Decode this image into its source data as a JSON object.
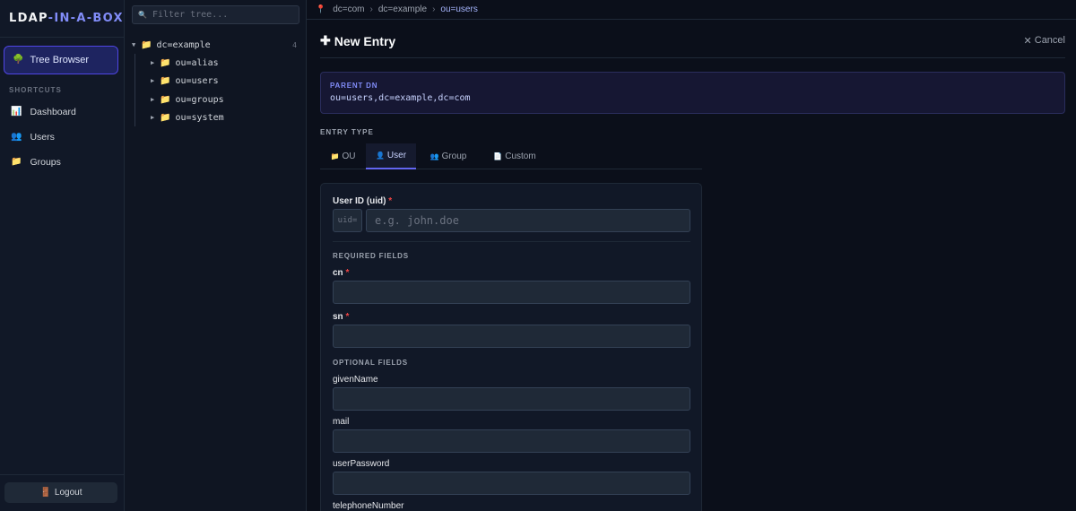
{
  "app": {
    "brand_a": "LDAP",
    "brand_b": "-IN-A-BOX"
  },
  "sidebar": {
    "active_item": {
      "label": "Tree Browser",
      "icon": "tree-icon"
    },
    "shortcuts_heading": "SHORTCUTS",
    "shortcuts": [
      {
        "label": "Dashboard",
        "icon": "chart-icon"
      },
      {
        "label": "Users",
        "icon": "users-icon"
      },
      {
        "label": "Groups",
        "icon": "folder-icon"
      }
    ],
    "logout_label": "Logout"
  },
  "tree": {
    "filter_placeholder": "Filter tree...",
    "root": {
      "label": "dc=example",
      "count": "4"
    },
    "children": [
      "ou=alias",
      "ou=users",
      "ou=groups",
      "ou=system"
    ]
  },
  "breadcrumb": [
    "dc=com",
    "dc=example",
    "ou=users"
  ],
  "form": {
    "title": "New Entry",
    "cancel_label": "Cancel",
    "parent_dn_label": "PARENT DN",
    "parent_dn_value": "ou=users,dc=example,dc=com",
    "entry_type_label": "ENTRY TYPE",
    "tabs": [
      {
        "label": "OU",
        "icon": "folder-icon",
        "active": false
      },
      {
        "label": "User",
        "icon": "user-icon",
        "active": true
      },
      {
        "label": "Group",
        "icon": "users-icon",
        "active": false
      },
      {
        "label": "Custom",
        "icon": "document-icon",
        "active": false
      }
    ],
    "uid_label": "User ID (uid)",
    "uid_prefix": "uid=",
    "uid_placeholder": "e.g. john.doe",
    "required_heading": "REQUIRED FIELDS",
    "required_fields": [
      "cn",
      "sn"
    ],
    "optional_heading": "OPTIONAL FIELDS",
    "optional_fields": [
      "givenName",
      "mail",
      "userPassword",
      "telephoneNumber"
    ]
  },
  "colors": {
    "accent": "#6366f1",
    "required": "#ef4444",
    "background": "#0b0f1a"
  }
}
